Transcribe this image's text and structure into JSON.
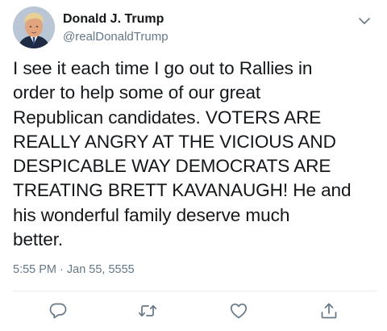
{
  "tweet": {
    "author": {
      "display_name": "Donald J. Trump",
      "handle": "@realDonaldTrump"
    },
    "lines": [
      "I see it each time I go out to Rallies in",
      "order to help some of our great",
      "Republican candidates. VOTERS ARE",
      "REALLY ANGRY AT THE VICIOUS AND",
      "DESPICABLE WAY DEMOCRATS ARE",
      "TREATING BRETT KAVANAUGH! He and",
      "his wonderful family deserve much",
      "better."
    ],
    "timestamp": "5:55 PM · Jan 55, 5555"
  },
  "icons": {
    "menu": "chevron-down-icon",
    "reply": "reply-icon",
    "retweet": "retweet-icon",
    "like": "heart-icon",
    "share": "share-icon"
  },
  "colors": {
    "text": "#14171a",
    "secondary": "#657786",
    "icon": "#657786",
    "divider": "#e6ecf0"
  }
}
